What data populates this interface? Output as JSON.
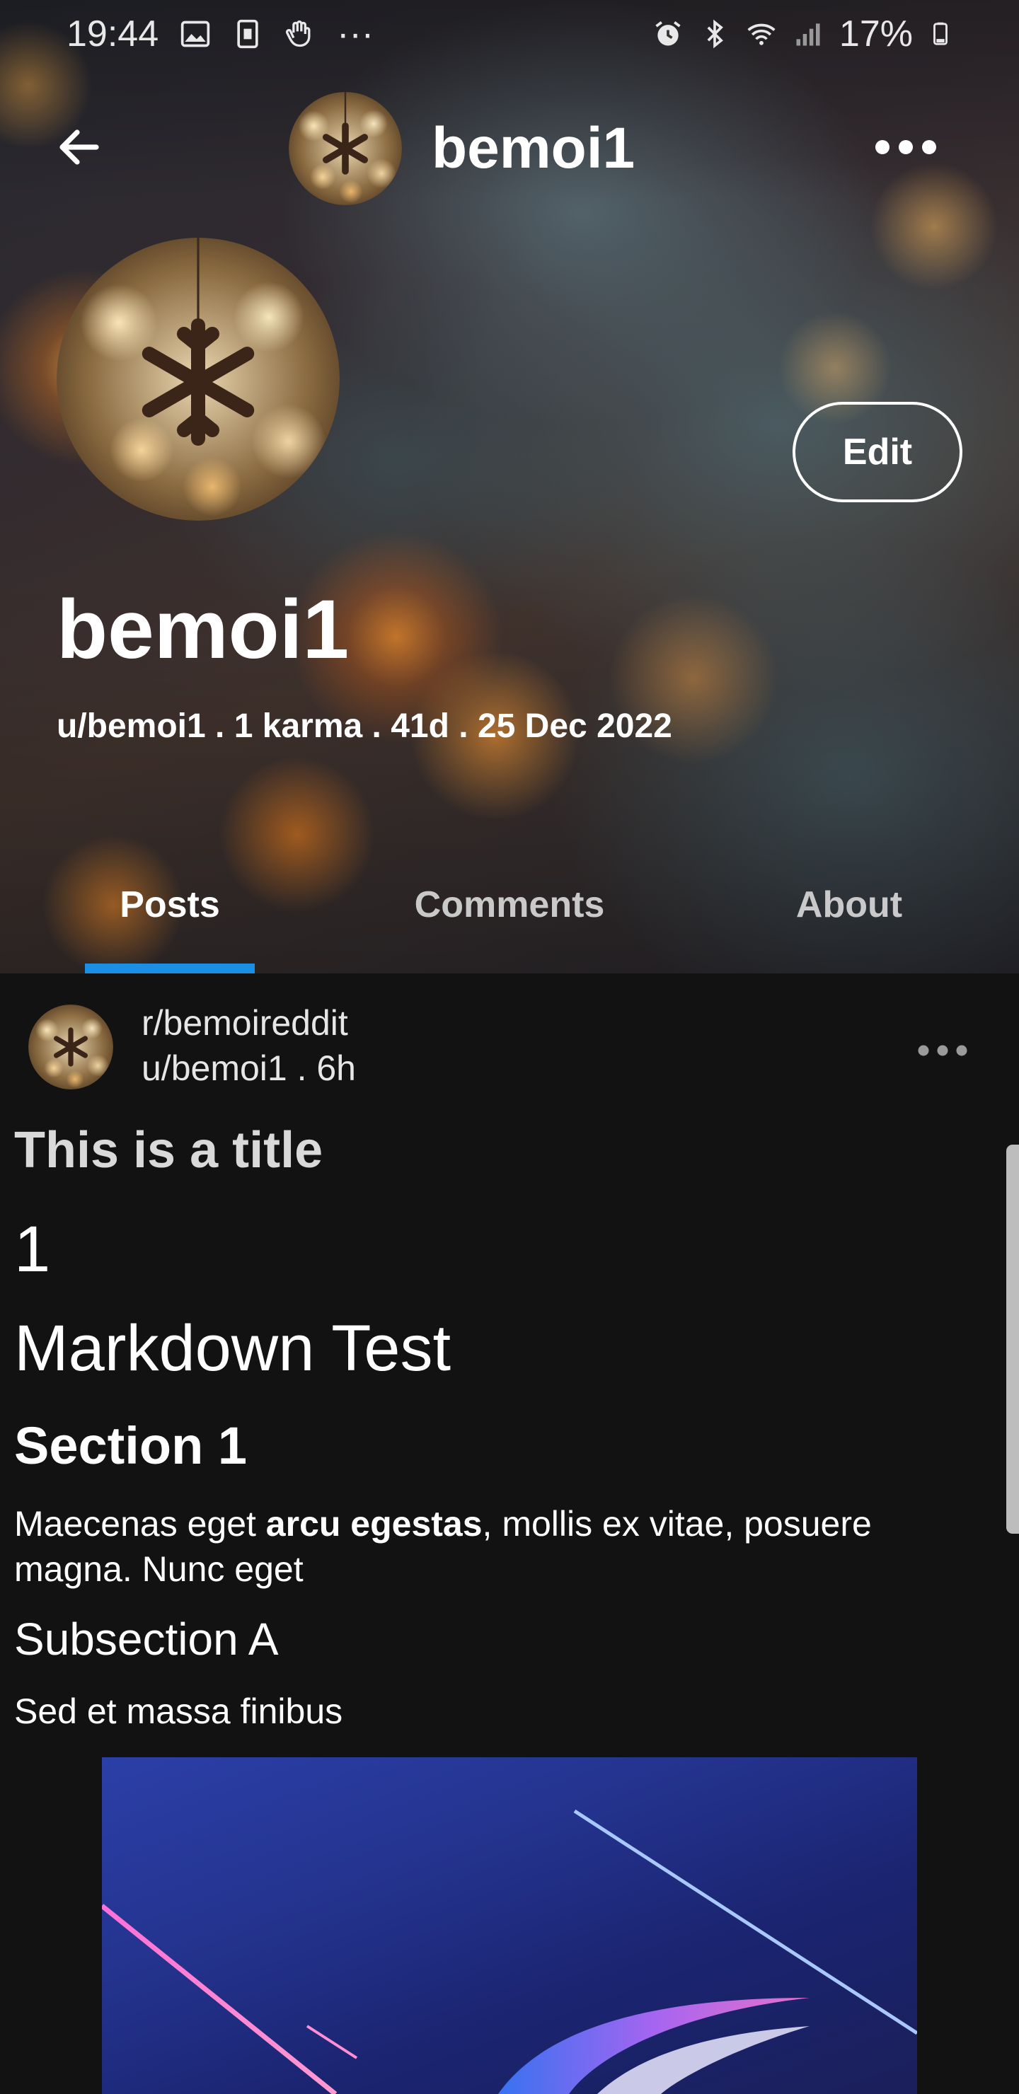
{
  "status_bar": {
    "time": "19:44",
    "dots": "···",
    "battery": "17%",
    "icons": [
      "image-icon",
      "sim-icon",
      "hand-icon",
      "alarm-icon",
      "bluetooth-icon",
      "wifi-icon",
      "signal-icon",
      "battery-icon"
    ]
  },
  "app_bar": {
    "title": "bemoi1"
  },
  "profile": {
    "edit_label": "Edit",
    "display_name": "bemoi1",
    "meta": {
      "username": "u/bemoi1",
      "sep1": " . ",
      "karma": "1 karma",
      "sep2": " . ",
      "age": "41d",
      "sep3": " .  ",
      "cake_day": "25 Dec 2022"
    }
  },
  "tabs": [
    {
      "label": "Posts",
      "active": true
    },
    {
      "label": "Comments",
      "active": false
    },
    {
      "label": "About",
      "active": false
    }
  ],
  "post": {
    "subreddit": "r/bemoireddit",
    "meta": "u/bemoi1 . 6h",
    "title": "This is a title",
    "body": {
      "h1_a": "1",
      "h1_b": "Markdown Test",
      "h2": "Section 1",
      "p1_pre": "Maecenas eget ",
      "p1_bold": "arcu egestas",
      "p1_post": ", mollis ex vitae, posuere magna. Nunc eget",
      "h3": "Subsection A",
      "p2": "Sed et massa finibus"
    }
  },
  "colors": {
    "background": "#121212",
    "accent": "#1a8fe3",
    "tab_inactive": "#c9c9c9"
  }
}
